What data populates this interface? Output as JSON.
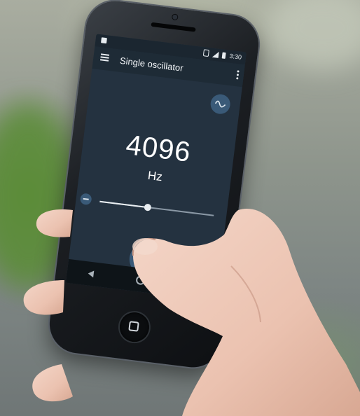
{
  "app": {
    "title": "Single oscillator",
    "status_time": "3:30"
  },
  "oscillator": {
    "frequency": "4096",
    "unit": "Hz",
    "slider_level": 0.42
  },
  "icons": {
    "menu": "hamburger-menu-icon",
    "more": "more-vertical-icon",
    "waveform": "sine-wave-icon",
    "decrease": "minus-icon",
    "play": "play-button",
    "nav_back": "back-triangle-icon",
    "nav_home": "home-circle-icon",
    "nav_recent": "recent-square-icon"
  },
  "colors": {
    "screen_bg": "#243240",
    "appbar_bg": "#1e2b36",
    "accent": "#3a5a78",
    "text": "#ffffff"
  }
}
